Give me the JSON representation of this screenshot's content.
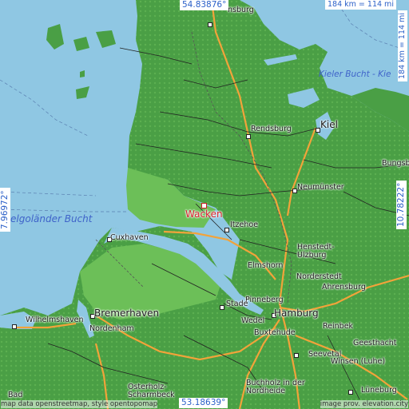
{
  "map": {
    "highlight_city": "Wacken",
    "colors": {
      "water": "#8fc7e3",
      "land": "#4a9f45",
      "land_light": "#6cbf58",
      "motorway": "#f2a33a",
      "road": "#222222",
      "marker": "#d4202a",
      "grid_text": "#2a5fc8"
    },
    "coords": {
      "top": "54.83876°",
      "bottom": "53.18639°",
      "left": "7.96972°",
      "right": "10.78222°"
    },
    "scale": {
      "horizontal": "184 km = 114 mi",
      "vertical": "184 km = 114 mi"
    },
    "water_labels": {
      "kieler_bucht": "Kieler Bucht - Kie",
      "helgolaender": "Helgoländer Bucht"
    },
    "cities": {
      "flensburg": "nsburg",
      "kiel": "Kiel",
      "rendsburg": "Rendsburg",
      "bungsb": "Bungsb",
      "neumuenster": "Neumünster",
      "wacken": "Wacken",
      "itzehoe": "Itzehoe",
      "cuxhaven": "Cuxhaven",
      "henstedt": "Henstedt-\nUlzburg",
      "elmshorn": "Elmshorn",
      "norderstedt": "Norderstedt",
      "ahrensburg": "Ahrensburg",
      "bremerhaven": "Bremerhaven",
      "wilhelmshaven": "Wilhelmshaven",
      "nordenham": "Nordenham",
      "stade": "Stade",
      "pinneberg": "Pinneberg",
      "hamburg": "Hamburg",
      "wedel": "Wedel",
      "reinbek": "Reinbek",
      "buxtehude": "Buxtehude",
      "geesthacht": "Geesthacht",
      "seevetal": "Seevetal",
      "winsen": "Winsen (Luhe)",
      "osterholz": "Osterholz-\nScharmbeck",
      "buchholz": "Buchholz in der\nNordheide",
      "lueneburg": "Lüneburg",
      "bad": "Bad"
    },
    "credits": {
      "left": "map data openstreetmap, style opentopomap",
      "right": "image prov. elevation.city"
    }
  }
}
